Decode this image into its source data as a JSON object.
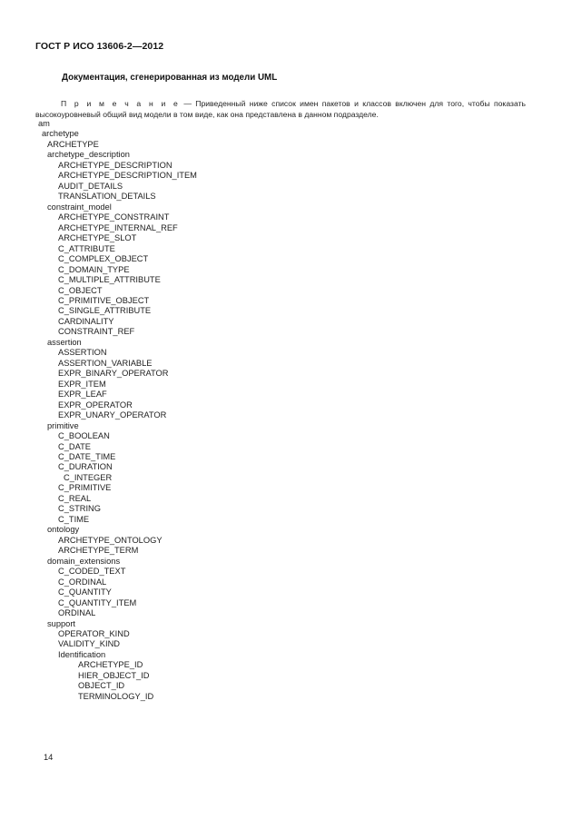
{
  "document": {
    "running_head": "ГОСТ Р ИСО 13606-2—2012",
    "section_title": "Документация, сгенерированная из модели UML",
    "page_number": "14"
  },
  "note": {
    "label": "П р и м е ч а н и е",
    "dash": "—",
    "text": "Приведенный ниже список имен пакетов и классов включен для того, чтобы показать высокоуровневый общий вид модели в том виде, как она представлена в данном подразделе."
  },
  "tree": {
    "lines": [
      {
        "label": "am",
        "level": 0
      },
      {
        "label": "archetype",
        "level": 1
      },
      {
        "label": "ARCHETYPE",
        "level": 2
      },
      {
        "label": "archetype_description",
        "level": 2
      },
      {
        "label": "ARCHETYPE_DESCRIPTION",
        "level": 3
      },
      {
        "label": "ARCHETYPE_DESCRIPTION_ITEM",
        "level": 3
      },
      {
        "label": "AUDIT_DETAILS",
        "level": 3
      },
      {
        "label": "TRANSLATION_DETAILS",
        "level": 3
      },
      {
        "label": "constraint_model",
        "level": 2
      },
      {
        "label": "ARCHETYPE_CONSTRAINT",
        "level": 3
      },
      {
        "label": "ARCHETYPE_INTERNAL_REF",
        "level": 3
      },
      {
        "label": "ARCHETYPE_SLOT",
        "level": 3
      },
      {
        "label": "C_ATTRIBUTE",
        "level": 3
      },
      {
        "label": "C_COMPLEX_OBJECT",
        "level": 3
      },
      {
        "label": "C_DOMAIN_TYPE",
        "level": 3
      },
      {
        "label": "C_MULTIPLE_ATTRIBUTE",
        "level": 3
      },
      {
        "label": "C_OBJECT",
        "level": 3
      },
      {
        "label": "C_PRIMITIVE_OBJECT",
        "level": 3
      },
      {
        "label": "C_SINGLE_ATTRIBUTE",
        "level": 3
      },
      {
        "label": "CARDINALITY",
        "level": 3
      },
      {
        "label": "CONSTRAINT_REF",
        "level": 3
      },
      {
        "label": "assertion",
        "level": 2
      },
      {
        "label": "ASSERTION",
        "level": 3
      },
      {
        "label": "ASSERTION_VARIABLE",
        "level": 3
      },
      {
        "label": "EXPR_BINARY_OPERATOR",
        "level": 3
      },
      {
        "label": "EXPR_ITEM",
        "level": 3
      },
      {
        "label": "EXPR_LEAF",
        "level": 3
      },
      {
        "label": "EXPR_OPERATOR",
        "level": 3
      },
      {
        "label": "EXPR_UNARY_OPERATOR",
        "level": 3
      },
      {
        "label": "primitive",
        "level": 2
      },
      {
        "label": "C_BOOLEAN",
        "level": 3
      },
      {
        "label": "C_DATE",
        "level": 3
      },
      {
        "label": "C_DATE_TIME",
        "level": 3
      },
      {
        "label": "C_DURATION",
        "level": 3
      },
      {
        "label": "C_INTEGER",
        "level": 4
      },
      {
        "label": "C_PRIMITIVE",
        "level": 3
      },
      {
        "label": "C_REAL",
        "level": 3
      },
      {
        "label": "C_STRING",
        "level": 3
      },
      {
        "label": "C_TIME",
        "level": 3
      },
      {
        "label": "ontology",
        "level": 2
      },
      {
        "label": "ARCHETYPE_ONTOLOGY",
        "level": 3
      },
      {
        "label": "ARCHETYPE_TERM",
        "level": 3
      },
      {
        "label": "domain_extensions",
        "level": 2
      },
      {
        "label": "C_CODED_TEXT",
        "level": 3
      },
      {
        "label": "C_ORDINAL",
        "level": 3
      },
      {
        "label": "C_QUANTITY",
        "level": 3
      },
      {
        "label": "C_QUANTITY_ITEM",
        "level": 3
      },
      {
        "label": "ORDINAL",
        "level": 3
      },
      {
        "label": "support",
        "level": 2
      },
      {
        "label": "OPERATOR_KIND",
        "level": 3
      },
      {
        "label": "VALIDITY_KIND",
        "level": 3
      },
      {
        "label": "Identification",
        "level": 3
      },
      {
        "label": "ARCHETYPE_ID",
        "level": 5
      },
      {
        "label": "HIER_OBJECT_ID",
        "level": 5
      },
      {
        "label": "OBJECT_ID",
        "level": 5
      },
      {
        "label": "TERMINOLOGY_ID",
        "level": 5
      }
    ]
  }
}
